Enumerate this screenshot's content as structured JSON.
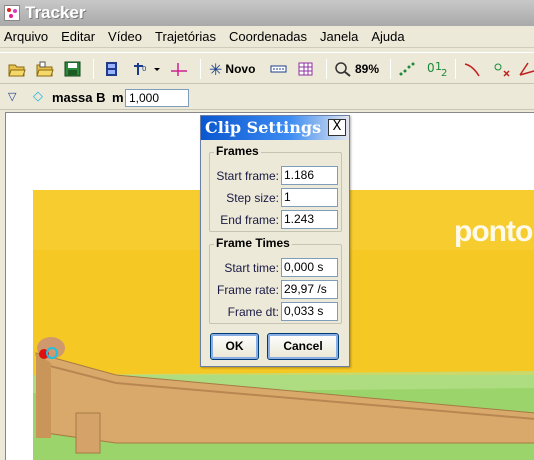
{
  "window": {
    "title": "Tracker"
  },
  "menu": [
    "Arquivo",
    "Editar",
    "Vídeo",
    "Trajetórias",
    "Coordenadas",
    "Janela",
    "Ajuda"
  ],
  "toolbar": {
    "new_track_label": "Novo",
    "zoom_label": "89%"
  },
  "trackbar": {
    "track_name": "massa B",
    "mass_label": "m",
    "mass_value": "1,000"
  },
  "video": {
    "watermark": "ponto"
  },
  "dialog": {
    "title": "Clip Settings",
    "close_label": "X",
    "frames_group": "Frames",
    "start_frame_label": "Start frame:",
    "start_frame_value": "1.186",
    "step_size_label": "Step size:",
    "step_size_value": "1",
    "end_frame_label": "End frame:",
    "end_frame_value": "1.243",
    "frame_times_group": "Frame Times",
    "start_time_label": "Start time:",
    "start_time_value": "0,000 s",
    "frame_rate_label": "Frame rate:",
    "frame_rate_value": "29,97 /s",
    "frame_dt_label": "Frame dt:",
    "frame_dt_value": "0,033 s",
    "ok_label": "OK",
    "cancel_label": "Cancel"
  },
  "colors": {
    "dialog_title_start": "#0a56d0",
    "video_background": "#f6c824",
    "table_surface": "#9bd46a",
    "track_wood": "#d9a96c"
  }
}
